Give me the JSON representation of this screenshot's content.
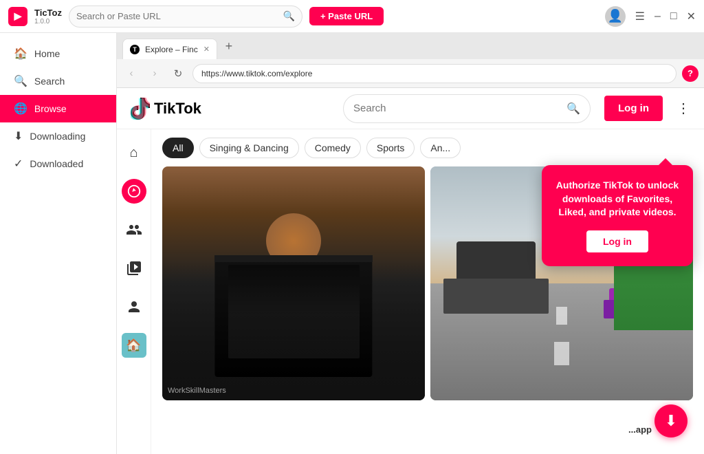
{
  "app": {
    "name": "TicToz",
    "version": "1.0.0",
    "logo_letter": "▶"
  },
  "titlebar": {
    "search_placeholder": "Search or Paste URL",
    "search_value": "",
    "paste_url_label": "+ Paste URL"
  },
  "sidebar": {
    "items": [
      {
        "id": "home",
        "label": "Home",
        "icon": "🏠",
        "active": false
      },
      {
        "id": "search",
        "label": "Search",
        "icon": "🔍",
        "active": false
      },
      {
        "id": "browse",
        "label": "Browse",
        "icon": "🌐",
        "active": true
      },
      {
        "id": "downloading",
        "label": "Downloading",
        "icon": "⬇",
        "active": false
      },
      {
        "id": "downloaded",
        "label": "Downloaded",
        "icon": "✓",
        "active": false
      }
    ]
  },
  "browser": {
    "tab_label": "Explore – Finc",
    "url": "https://www.tiktok.com/explore",
    "can_go_back": false,
    "can_go_forward": false
  },
  "tiktok": {
    "logo_text": "TikTok",
    "search_placeholder": "Search",
    "login_label": "Log in",
    "more_icon": "⋮",
    "categories": [
      {
        "id": "all",
        "label": "All",
        "active": true
      },
      {
        "id": "singing",
        "label": "Singing & Dancing",
        "active": false
      },
      {
        "id": "comedy",
        "label": "Comedy",
        "active": false
      },
      {
        "id": "sports",
        "label": "Sports",
        "active": false
      },
      {
        "id": "anime",
        "label": "An...",
        "active": false
      }
    ],
    "auth_popup": {
      "text": "Authorize TikTok to unlock downloads of Favorites, Liked, and private videos.",
      "login_label": "Log in"
    },
    "video_label": "WorkSkillMasters",
    "app_label": "...app"
  },
  "window_controls": {
    "menu": "☰",
    "minimize": "–",
    "maximize": "□",
    "close": "✕"
  },
  "icons": {
    "search": "🔍",
    "back": "‹",
    "forward": "›",
    "refresh": "↻",
    "help": "?",
    "download": "⬇",
    "home": "⌂",
    "compass": "🧭",
    "friends": "👥",
    "video": "📹",
    "person": "👤",
    "special": "🏠"
  }
}
